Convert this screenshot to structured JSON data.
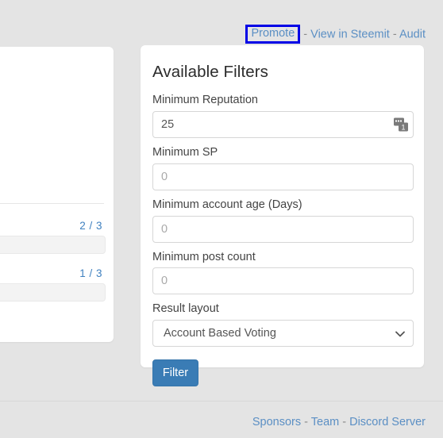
{
  "topbar": {
    "promote_label": "Promote",
    "separator": " - ",
    "view_in_steemit_label": "View in Steemit",
    "audit_label": "Audit",
    "promote_highlight_color": "#0000e6",
    "link_color": "#5b8fc4"
  },
  "left_card": {
    "rows": [
      {
        "count_label": "2 / 3"
      },
      {
        "count_label": "1 / 3"
      }
    ]
  },
  "filters": {
    "title": "Available Filters",
    "fields": [
      {
        "label": "Minimum Reputation",
        "value": "25",
        "placeholder": "",
        "is_placeholder": false,
        "has_autofill_icon": true
      },
      {
        "label": "Minimum SP",
        "value": "0",
        "placeholder": "0",
        "is_placeholder": true,
        "has_autofill_icon": false
      },
      {
        "label": "Minimum account age (Days)",
        "value": "0",
        "placeholder": "0",
        "is_placeholder": true,
        "has_autofill_icon": false
      },
      {
        "label": "Minimum post count",
        "value": "0",
        "placeholder": "0",
        "is_placeholder": true,
        "has_autofill_icon": false
      }
    ],
    "result_layout": {
      "label": "Result layout",
      "selected": "Account Based Voting"
    },
    "submit_label": "Filter",
    "submit_color": "#3a7cb5"
  },
  "footer": {
    "sponsors_label": "Sponsors",
    "team_label": "Team",
    "discord_label": "Discord Server",
    "separator": " - "
  }
}
